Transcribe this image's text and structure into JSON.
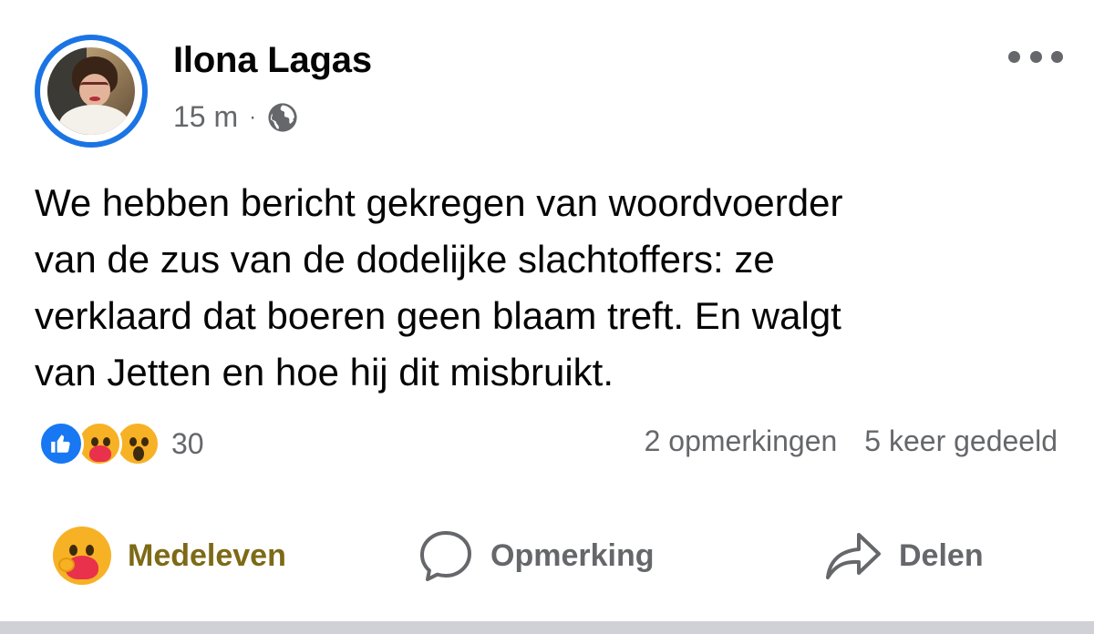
{
  "post": {
    "author": "Ilona Lagas",
    "time": "15 m",
    "separator": "·",
    "privacy_icon": "globe-icon",
    "more_icon": "more-options-icon",
    "text_lines": [
      "We hebben bericht gekregen van woordvoerder",
      "van de zus van de dodelijke slachtoffers: ze",
      "verklaard dat boeren geen blaam treft. En walgt",
      "van Jetten en hoe hij dit misbruikt."
    ]
  },
  "reactions": {
    "icons": [
      "like-reaction-icon",
      "care-reaction-icon",
      "wow-reaction-icon"
    ],
    "count": "30"
  },
  "stats": {
    "comments": "2 opmerkingen",
    "shares": "5 keer gedeeld"
  },
  "actions": {
    "care_label": "Medeleven",
    "comment_label": "Opmerking",
    "share_label": "Delen"
  },
  "colors": {
    "accent_blue": "#1b74e4",
    "care_label": "#7d6a16",
    "secondary_text": "#65676b"
  }
}
